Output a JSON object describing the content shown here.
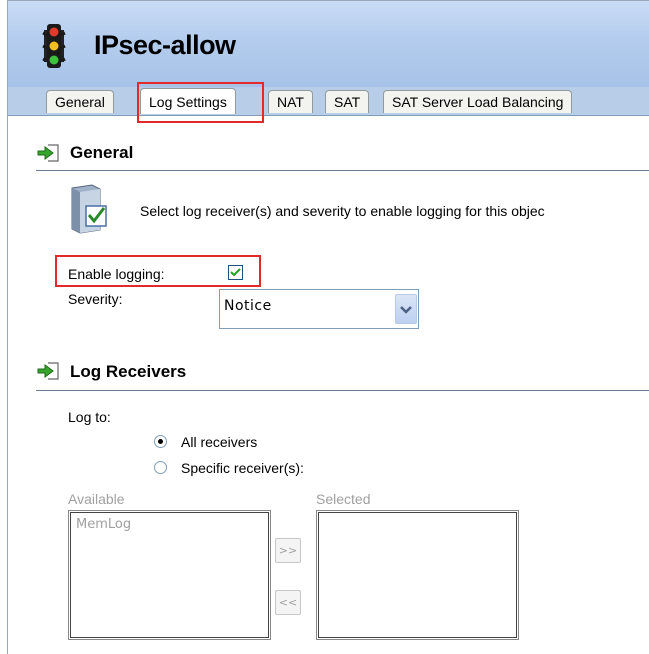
{
  "window": {
    "title": "IPsec-allow"
  },
  "tabs": [
    {
      "label": "General"
    },
    {
      "label": "Log Settings"
    },
    {
      "label": "NAT"
    },
    {
      "label": "SAT"
    },
    {
      "label": "SAT Server Load Balancing"
    }
  ],
  "active_tab": "Log Settings",
  "general": {
    "heading": "General",
    "info_text": "Select log receiver(s) and severity to enable logging for this objec",
    "enable_logging_label": "Enable logging:",
    "enable_logging_checked": true,
    "severity_label": "Severity:",
    "severity_value": "Notice"
  },
  "log_receivers": {
    "heading": "Log Receivers",
    "log_to_label": "Log to:",
    "option_all": "All receivers",
    "option_specific": "Specific receiver(s):",
    "selected_option": "All receivers",
    "available_label": "Available",
    "available_items": [
      "MemLog"
    ],
    "selected_label": "Selected",
    "selected_items": [],
    "add_button": ">>",
    "remove_button": "<<"
  },
  "icons": {
    "title_icon": "traffic-light-icon",
    "section_icon": "section-arrow-icon",
    "info_icon": "server-check-icon"
  },
  "colors": {
    "highlight": "#e22a2a",
    "title_bar": "#b4cdee",
    "tab_bar": "#b8cde8",
    "check": "#21a121"
  }
}
